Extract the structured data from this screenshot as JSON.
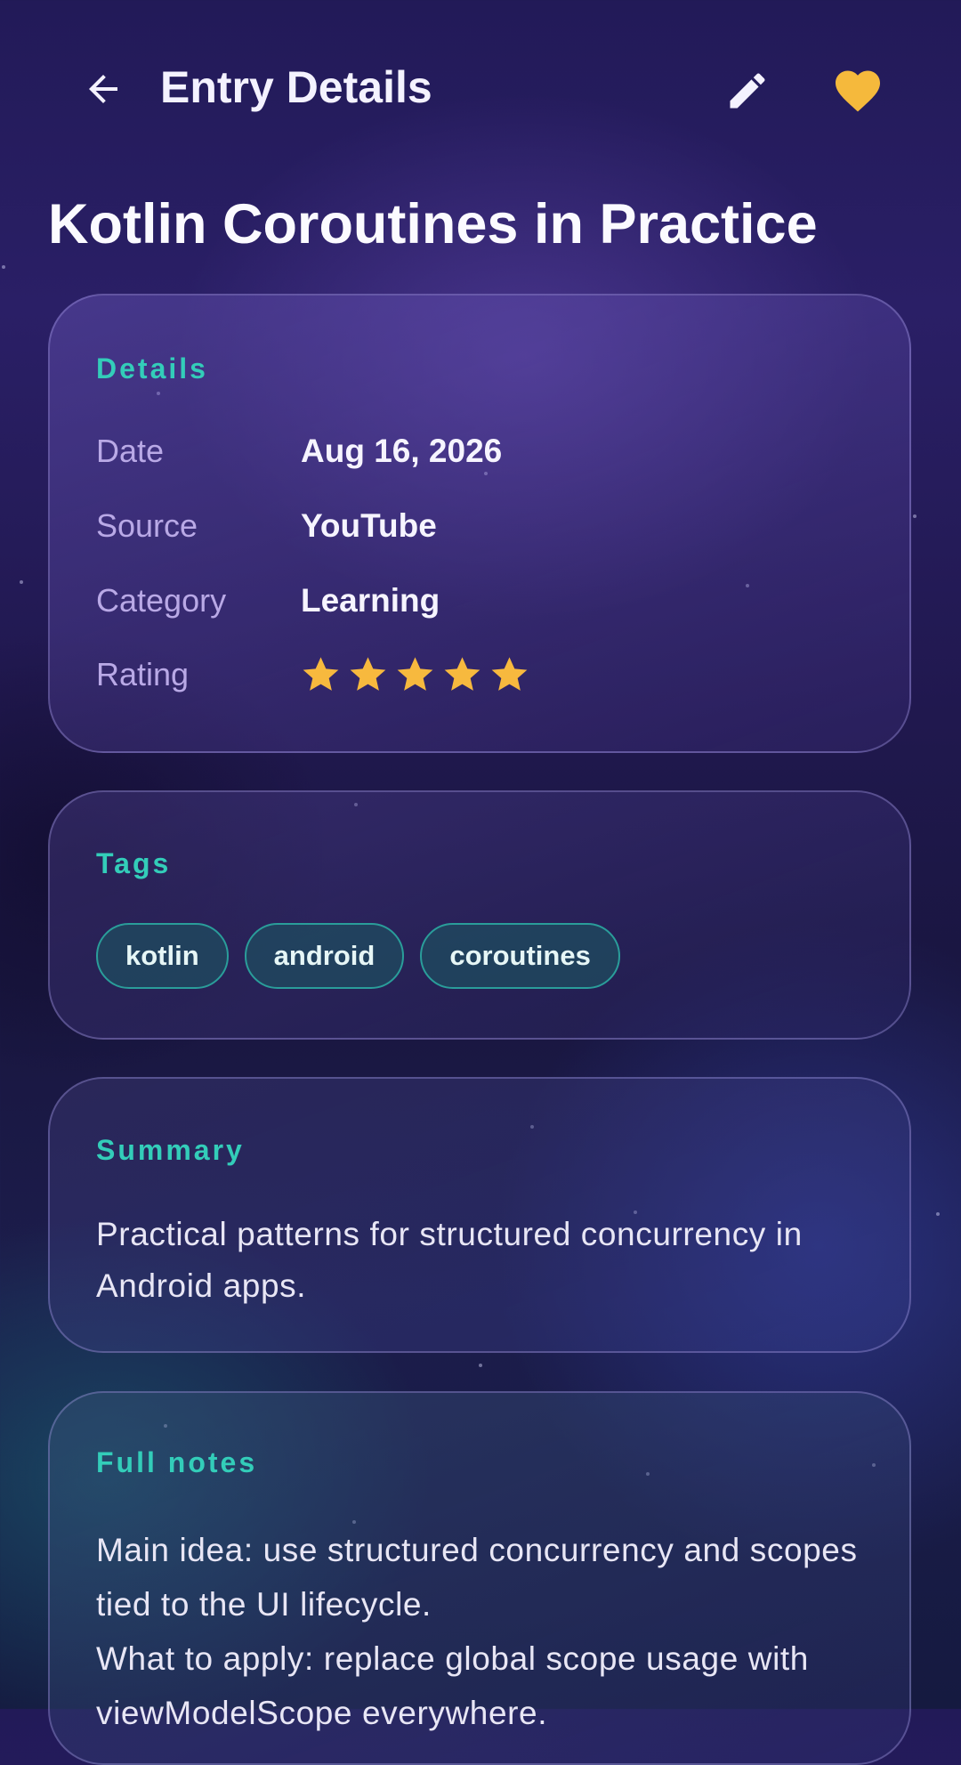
{
  "appbar": {
    "title": "Entry Details",
    "back_icon": "arrow-left-icon",
    "edit_icon": "pencil-icon",
    "favorite_icon": "heart-icon",
    "favorite_color": "#f5b93c"
  },
  "entry": {
    "title": "Kotlin Coroutines in Practice"
  },
  "details": {
    "heading": "Details",
    "rows": [
      {
        "label": "Date",
        "value": "Aug 16, 2026"
      },
      {
        "label": "Source",
        "value": "YouTube"
      },
      {
        "label": "Category",
        "value": "Learning"
      }
    ],
    "rating_label": "Rating",
    "rating": 5,
    "rating_max": 5,
    "star_color": "#f7b93e"
  },
  "tags": {
    "heading": "Tags",
    "items": [
      "kotlin",
      "android",
      "coroutines"
    ]
  },
  "summary": {
    "heading": "Summary",
    "text": "Practical patterns for structured concurrency in Android apps."
  },
  "notes": {
    "heading": "Full notes",
    "lines": [
      "Main idea: use structured concurrency and scopes tied to the UI lifecycle.",
      "What to apply: replace global scope usage with viewModelScope everywhere."
    ]
  },
  "colors": {
    "accent": "#33cdb9",
    "label": "#b9a9e6",
    "chip_border": "#2a9d9a"
  }
}
